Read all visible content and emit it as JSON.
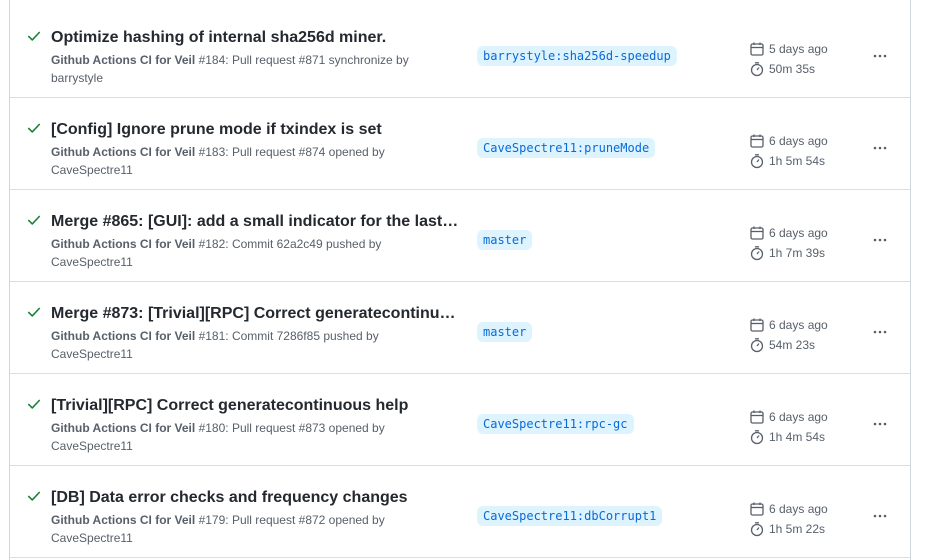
{
  "runs": [
    {
      "title": "Optimize hashing of internal sha256d miner.",
      "workflow": "Github Actions CI for Veil",
      "run_number": "#184",
      "event_text": ": Pull request #871 synchronize by",
      "actor": "barrystyle",
      "branch": "barrystyle:sha256d-speedup",
      "date": "5 days ago",
      "duration": "50m 35s"
    },
    {
      "title": "[Config] Ignore prune mode if txindex is set",
      "workflow": "Github Actions CI for Veil",
      "run_number": "#183",
      "event_text": ": Pull request #874 opened by",
      "actor": "CaveSpectre11",
      "branch": "CaveSpectre11:pruneMode",
      "date": "6 days ago",
      "duration": "1h 5m 54s"
    },
    {
      "title": "Merge #865: [GUI]: add a small indicator for the last…",
      "workflow": "Github Actions CI for Veil",
      "run_number": "#182",
      "event_text": ": Commit 62a2c49 pushed by",
      "actor": "CaveSpectre11",
      "branch": "master",
      "date": "6 days ago",
      "duration": "1h 7m 39s"
    },
    {
      "title": "Merge #873: [Trivial][RPC] Correct generatecontinu…",
      "workflow": "Github Actions CI for Veil",
      "run_number": "#181",
      "event_text": ": Commit 7286f85 pushed by",
      "actor": "CaveSpectre11",
      "branch": "master",
      "date": "6 days ago",
      "duration": "54m 23s"
    },
    {
      "title": "[Trivial][RPC] Correct generatecontinuous help",
      "workflow": "Github Actions CI for Veil",
      "run_number": "#180",
      "event_text": ": Pull request #873 opened by",
      "actor": "CaveSpectre11",
      "branch": "CaveSpectre11:rpc-gc",
      "date": "6 days ago",
      "duration": "1h 4m 54s"
    },
    {
      "title": "[DB] Data error checks and frequency changes",
      "workflow": "Github Actions CI for Veil",
      "run_number": "#179",
      "event_text": ": Pull request #872 opened by",
      "actor": "CaveSpectre11",
      "branch": "CaveSpectre11:dbCorrupt1",
      "date": "6 days ago",
      "duration": "1h 5m 22s"
    }
  ],
  "colors": {
    "success": "#1a7f37",
    "branch_bg": "#ddf4ff",
    "branch_fg": "#0969da",
    "muted": "#57606a"
  },
  "icons": {
    "status": "check-icon",
    "date": "calendar-icon",
    "duration": "stopwatch-icon",
    "menu": "kebab-horizontal-icon"
  }
}
